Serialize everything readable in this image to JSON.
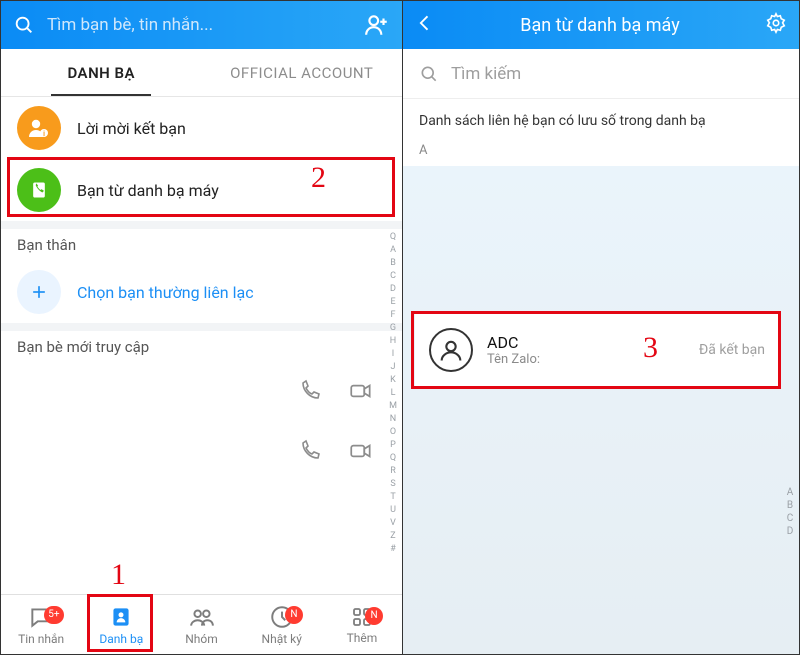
{
  "left": {
    "search_placeholder": "Tìm bạn bè, tin nhắn...",
    "tabs": {
      "contacts": "DANH BẠ",
      "official": "OFFICIAL ACCOUNT"
    },
    "rows": {
      "friend_requests": "Lời mời kết bạn",
      "phone_contacts": "Bạn từ danh bạ máy"
    },
    "sections": {
      "close_friends": "Bạn thân",
      "choose_frequent": "Chọn bạn thường liên lạc",
      "recent_access": "Bạn bè mới truy cập"
    },
    "alpha_index": [
      "Q",
      "A",
      "B",
      "C",
      "D",
      "E",
      "F",
      "G",
      "H",
      "I",
      "J",
      "K",
      "L",
      "M",
      "N",
      "O",
      "P",
      "Q",
      "R",
      "S",
      "T",
      "U",
      "V",
      "Z",
      "#"
    ],
    "nav": {
      "messages": {
        "label": "Tin nhắn",
        "badge": "5+"
      },
      "contacts": {
        "label": "Danh bạ"
      },
      "groups": {
        "label": "Nhóm"
      },
      "timeline": {
        "label": "Nhật ký",
        "badge": "N"
      },
      "more": {
        "label": "Thêm",
        "badge": "N"
      }
    }
  },
  "right": {
    "title": "Bạn từ danh bạ máy",
    "search_placeholder": "Tìm kiếm",
    "description": "Danh sách liên hệ bạn có lưu số trong danh bạ",
    "letter": "A",
    "contact": {
      "name": "ADC",
      "sub_label": "Tên Zalo:",
      "status": "Đã kết bạn"
    },
    "alpha_index": [
      "A",
      "B",
      "C",
      "D"
    ]
  },
  "callouts": {
    "one": "1",
    "two": "2",
    "three": "3"
  }
}
